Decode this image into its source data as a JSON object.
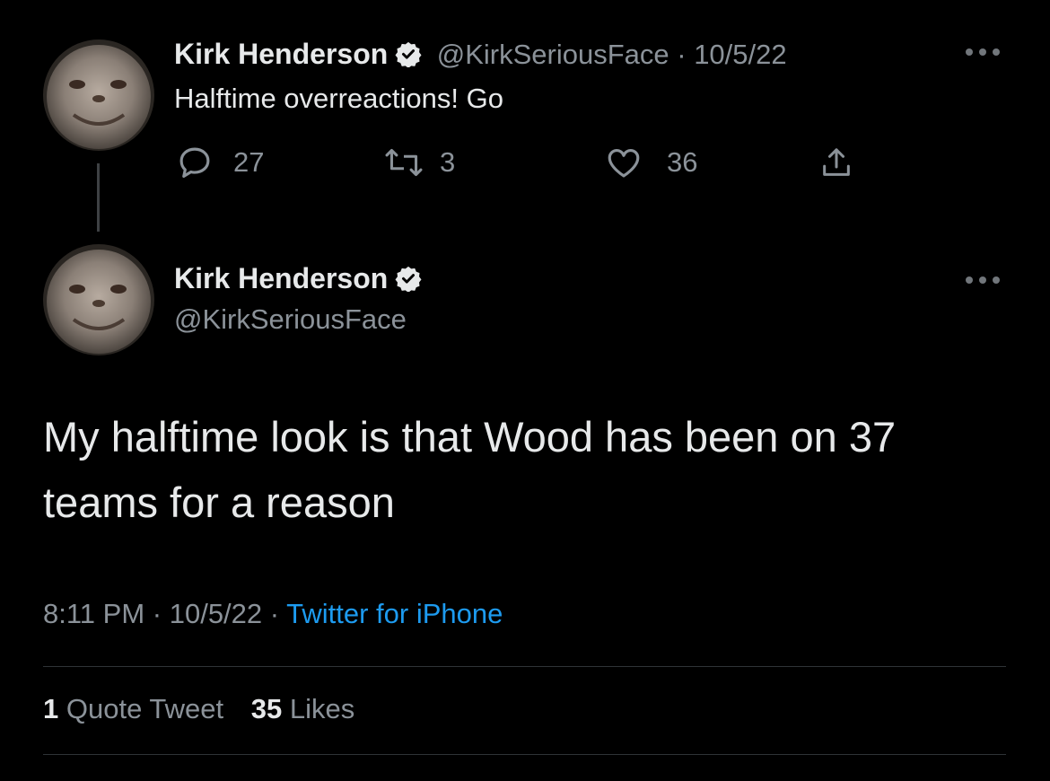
{
  "parent_tweet": {
    "display_name": "Kirk Henderson",
    "handle": "@KirkSeriousFace",
    "separator": " · ",
    "date": "10/5/22",
    "text": "Halftime overreactions! Go",
    "replies": "27",
    "retweets": "3",
    "likes": "36"
  },
  "main_tweet": {
    "display_name": "Kirk Henderson",
    "handle": "@KirkSeriousFace",
    "text": "My halftime look is that Wood has been on 37 teams for a reason",
    "time": "8:11 PM",
    "separator_1": " · ",
    "date": "10/5/22",
    "separator_2": " · ",
    "source": "Twitter for iPhone",
    "quote_count": "1",
    "quote_label": "Quote Tweet",
    "like_count": "35",
    "like_label": "Likes"
  },
  "icons": {
    "verified": "verified-badge-icon",
    "reply": "reply-icon",
    "retweet": "retweet-icon",
    "like": "heart-icon",
    "share": "share-icon",
    "more": "more-options-icon"
  },
  "colors": {
    "background": "#000000",
    "primary_text": "#e7e9ea",
    "secondary_text": "#8b9299",
    "link": "#1d9bf0"
  }
}
